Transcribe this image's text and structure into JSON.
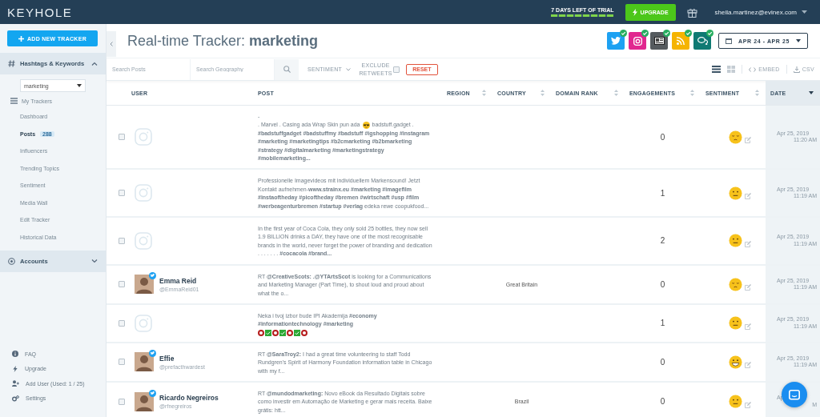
{
  "topbar": {
    "logo": "KEYHOLE",
    "trial": {
      "label": "7 DAYS LEFT OF TRIAL",
      "level": 1
    },
    "upgrade": "UPGRADE",
    "user_email": "sheila.martinez@evinex.com"
  },
  "sidebar": {
    "add_button": "ADD NEW TRACKER",
    "hashtags_section": {
      "label": "Hashtags & Keywords",
      "expanded": true
    },
    "tracker_select": "marketing",
    "my_trackers": "My Trackers",
    "items": [
      {
        "label": "Dashboard",
        "selected": false
      },
      {
        "label": "Posts",
        "selected": true,
        "badge": "288"
      },
      {
        "label": "Influencers",
        "selected": false
      },
      {
        "label": "Trending Topics",
        "selected": false
      },
      {
        "label": "Sentiment",
        "selected": false
      },
      {
        "label": "Media Wall",
        "selected": false
      },
      {
        "label": "Edit Tracker",
        "selected": false
      },
      {
        "label": "Historical Data",
        "selected": false
      }
    ],
    "accounts_section": {
      "label": "Accounts",
      "expanded": false
    },
    "footer_items": [
      {
        "label": "FAQ",
        "kind": "info"
      },
      {
        "label": "Upgrade",
        "kind": "bolt"
      },
      {
        "label": "Add User (Used: 1 / 25)",
        "kind": "add-user"
      },
      {
        "label": "Settings",
        "kind": "gears"
      }
    ]
  },
  "header": {
    "title": "Real-time Tracker: **marketing**",
    "sources": [
      {
        "kind": "twitter",
        "enabled": true
      },
      {
        "kind": "instagram",
        "enabled": true
      },
      {
        "kind": "news",
        "enabled": true
      },
      {
        "kind": "rss",
        "enabled": true
      },
      {
        "kind": "forum",
        "enabled": true
      }
    ],
    "date_range": "APR 24 - APR 25"
  },
  "toolbar": {
    "search_posts": {
      "placeholder": "Search Posts"
    },
    "search_geography": {
      "placeholder": "Search Geography"
    },
    "sentiment_filter": "SENTIMENT",
    "exclude_retweets": {
      "label": "EXCLUDE RETWEETS",
      "checked": false
    },
    "reset": "RESET",
    "views": [
      {
        "kind": "list",
        "selected": true
      },
      {
        "kind": "grid",
        "selected": false
      }
    ],
    "embed": "EMBED",
    "csv": "CSV"
  },
  "table": {
    "columns": [
      {
        "label": "USER",
        "sortable": false,
        "sorted": false
      },
      {
        "label": "POST",
        "sortable": false,
        "sorted": false
      },
      {
        "label": "REGION",
        "sortable": true,
        "sorted": false
      },
      {
        "label": "COUNTRY",
        "sortable": true,
        "sorted": false
      },
      {
        "label": "DOMAIN RANK",
        "sortable": true,
        "sorted": false
      },
      {
        "label": "ENGAGEMENTS",
        "sortable": true,
        "sorted": false
      },
      {
        "label": "SENTIMENT",
        "sortable": true,
        "sorted": false
      },
      {
        "label": "DATE",
        "sortable": true,
        "sorted": true
      }
    ],
    "rows": [
      {
        "checked": false,
        "user": {
          "kind": "instagram"
        },
        "post": [
          {
            "kind": "text",
            "text": "-"
          },
          {
            "kind": "emoji-line",
            "before": ". Marvel . Casing ada Wrap Skin pun ada",
            "after": "badstuff.gadget ."
          },
          {
            "kind": "text",
            "text": "**#badstuffgadget #badstuffmy #badstuff #igshopping #instagram #marketing #marketingtips #b2cmarketing #b2bmarketing #strategy #digitalmarketing #marketingstrategy #mobilemarketing...**"
          }
        ],
        "engagements": "0",
        "sentiment": {
          "kind": "content"
        },
        "date": "Apr 25, 2019",
        "time": "11:20 AM"
      },
      {
        "checked": false,
        "user": {
          "kind": "instagram"
        },
        "post": [
          {
            "kind": "text",
            "text": "Professionelle Imagevideos mit individuellem Markensound! Jetzt Kontakt aufnehmen-**www.strainx.eu #marketing #imagefilm #instaoftheday #picoftheday #bremen #wirtschaft #usp #film #werbeagenturbremen #startup #verlag** edeka rewe coopukfood..."
          }
        ],
        "engagements": "1",
        "sentiment": {
          "kind": "neutral"
        },
        "date": "Apr 25, 2019",
        "time": "11:19 AM"
      },
      {
        "checked": false,
        "user": {
          "kind": "instagram"
        },
        "post": [
          {
            "kind": "text",
            "text": "In the first year of Coca Cola, they only sold 25 bottles, they now sell 1.9 BILLION drinks a DAY, they have one of the most recognisable brands in the world, never forget the power of branding and dedication\n. . . . . . . **#cocacola #brand...**"
          }
        ],
        "engagements": "2",
        "sentiment": {
          "kind": "neutral"
        },
        "date": "Apr 25, 2019",
        "time": "11:19 AM"
      },
      {
        "checked": false,
        "user": {
          "kind": "twitter",
          "name": "Emma Reid",
          "handle": "@EmmaReid01"
        },
        "post": [
          {
            "kind": "text",
            "text": "RT **@CreativeScots:** **.@YTArtsScot** is looking for a Communications and Marketing Manager (Part Time), to shout loud and proud about what the o..."
          }
        ],
        "country": "Great Britain",
        "engagements": "0",
        "sentiment": {
          "kind": "content"
        },
        "date": "Apr 25, 2019",
        "time": "11:19 AM"
      },
      {
        "checked": false,
        "user": {
          "kind": "instagram"
        },
        "post": [
          {
            "kind": "text",
            "text": "Neka i tvoj izbor bude IPI Akademija **#economy #informationtechnology #marketing**"
          },
          {
            "kind": "marks",
            "marks": [
              {
                "kind": "ring"
              },
              {
                "kind": "check"
              },
              {
                "kind": "ring"
              },
              {
                "kind": "check"
              },
              {
                "kind": "ring"
              },
              {
                "kind": "check"
              },
              {
                "kind": "ring"
              }
            ]
          }
        ],
        "engagements": "1",
        "sentiment": {
          "kind": "neutral"
        },
        "date": "Apr 25, 2019",
        "time": "11:19 AM"
      },
      {
        "checked": false,
        "user": {
          "kind": "twitter",
          "name": "Effie",
          "handle": "@prefacthwardest"
        },
        "post": [
          {
            "kind": "text",
            "text": "RT **@SaraTroy2:** I had a great time volunteering to staff Todd Rundgren's Spirit of Harmony Foundation information table in Chicago with my f..."
          }
        ],
        "engagements": "0",
        "sentiment": {
          "kind": "happy"
        },
        "date": "Apr 25, 2019",
        "time": "11:19 AM"
      },
      {
        "checked": false,
        "user": {
          "kind": "twitter",
          "name": "Ricardo Negreiros",
          "handle": "@rfnegreiros"
        },
        "post": [
          {
            "kind": "text",
            "text": "RT **@mundodmarketing:** Novo eBook da Resultado Digitais sobre como investir em Automação de Marketing e gerar mais receita. Baixe grátis: htt..."
          }
        ],
        "country": "Brazil",
        "engagements": "0",
        "sentiment": {
          "kind": "neutral"
        },
        "date": "Ap",
        "time": "M"
      }
    ]
  }
}
